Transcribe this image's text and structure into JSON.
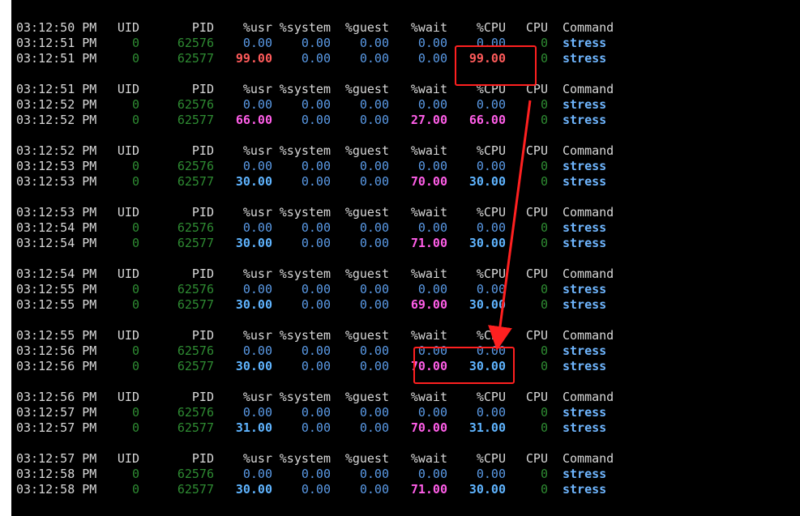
{
  "terminal": {
    "header": {
      "uid": "UID",
      "pid": "PID",
      "usr": "%usr",
      "system": "%system",
      "guest": "%guest",
      "wait": "%wait",
      "cpu_pct": "%CPU",
      "cpu": "CPU",
      "command": "Command"
    },
    "blocks": [
      {
        "header_time": "03:12:50 PM",
        "rows": [
          {
            "time": "03:12:51 PM",
            "uid": "0",
            "pid": "62576",
            "usr": "0.00",
            "system": "0.00",
            "guest": "0.00",
            "wait": "0.00",
            "cpu_pct": "0.00",
            "cpu": "0",
            "command": "stress"
          },
          {
            "time": "03:12:51 PM",
            "uid": "0",
            "pid": "62577",
            "usr": "99.00",
            "system": "0.00",
            "guest": "0.00",
            "wait": "0.00",
            "cpu_pct": "99.00",
            "cpu": "0",
            "command": "stress"
          }
        ]
      },
      {
        "header_time": "03:12:51 PM",
        "rows": [
          {
            "time": "03:12:52 PM",
            "uid": "0",
            "pid": "62576",
            "usr": "0.00",
            "system": "0.00",
            "guest": "0.00",
            "wait": "0.00",
            "cpu_pct": "0.00",
            "cpu": "0",
            "command": "stress"
          },
          {
            "time": "03:12:52 PM",
            "uid": "0",
            "pid": "62577",
            "usr": "66.00",
            "system": "0.00",
            "guest": "0.00",
            "wait": "27.00",
            "cpu_pct": "66.00",
            "cpu": "0",
            "command": "stress"
          }
        ]
      },
      {
        "header_time": "03:12:52 PM",
        "rows": [
          {
            "time": "03:12:53 PM",
            "uid": "0",
            "pid": "62576",
            "usr": "0.00",
            "system": "0.00",
            "guest": "0.00",
            "wait": "0.00",
            "cpu_pct": "0.00",
            "cpu": "0",
            "command": "stress"
          },
          {
            "time": "03:12:53 PM",
            "uid": "0",
            "pid": "62577",
            "usr": "30.00",
            "system": "0.00",
            "guest": "0.00",
            "wait": "70.00",
            "cpu_pct": "30.00",
            "cpu": "0",
            "command": "stress"
          }
        ]
      },
      {
        "header_time": "03:12:53 PM",
        "rows": [
          {
            "time": "03:12:54 PM",
            "uid": "0",
            "pid": "62576",
            "usr": "0.00",
            "system": "0.00",
            "guest": "0.00",
            "wait": "0.00",
            "cpu_pct": "0.00",
            "cpu": "0",
            "command": "stress"
          },
          {
            "time": "03:12:54 PM",
            "uid": "0",
            "pid": "62577",
            "usr": "30.00",
            "system": "0.00",
            "guest": "0.00",
            "wait": "71.00",
            "cpu_pct": "30.00",
            "cpu": "0",
            "command": "stress"
          }
        ]
      },
      {
        "header_time": "03:12:54 PM",
        "rows": [
          {
            "time": "03:12:55 PM",
            "uid": "0",
            "pid": "62576",
            "usr": "0.00",
            "system": "0.00",
            "guest": "0.00",
            "wait": "0.00",
            "cpu_pct": "0.00",
            "cpu": "0",
            "command": "stress"
          },
          {
            "time": "03:12:55 PM",
            "uid": "0",
            "pid": "62577",
            "usr": "30.00",
            "system": "0.00",
            "guest": "0.00",
            "wait": "69.00",
            "cpu_pct": "30.00",
            "cpu": "0",
            "command": "stress"
          }
        ]
      },
      {
        "header_time": "03:12:55 PM",
        "rows": [
          {
            "time": "03:12:56 PM",
            "uid": "0",
            "pid": "62576",
            "usr": "0.00",
            "system": "0.00",
            "guest": "0.00",
            "wait": "0.00",
            "cpu_pct": "0.00",
            "cpu": "0",
            "command": "stress"
          },
          {
            "time": "03:12:56 PM",
            "uid": "0",
            "pid": "62577",
            "usr": "30.00",
            "system": "0.00",
            "guest": "0.00",
            "wait": "70.00",
            "cpu_pct": "30.00",
            "cpu": "0",
            "command": "stress"
          }
        ]
      },
      {
        "header_time": "03:12:56 PM",
        "rows": [
          {
            "time": "03:12:57 PM",
            "uid": "0",
            "pid": "62576",
            "usr": "0.00",
            "system": "0.00",
            "guest": "0.00",
            "wait": "0.00",
            "cpu_pct": "0.00",
            "cpu": "0",
            "command": "stress"
          },
          {
            "time": "03:12:57 PM",
            "uid": "0",
            "pid": "62577",
            "usr": "31.00",
            "system": "0.00",
            "guest": "0.00",
            "wait": "70.00",
            "cpu_pct": "31.00",
            "cpu": "0",
            "command": "stress"
          }
        ]
      },
      {
        "header_time": "03:12:57 PM",
        "rows": [
          {
            "time": "03:12:58 PM",
            "uid": "0",
            "pid": "62576",
            "usr": "0.00",
            "system": "0.00",
            "guest": "0.00",
            "wait": "0.00",
            "cpu_pct": "0.00",
            "cpu": "0",
            "command": "stress"
          },
          {
            "time": "03:12:58 PM",
            "uid": "0",
            "pid": "62577",
            "usr": "30.00",
            "system": "0.00",
            "guest": "0.00",
            "wait": "71.00",
            "cpu_pct": "30.00",
            "cpu": "0",
            "command": "stress"
          }
        ]
      }
    ]
  },
  "colors": {
    "background": "#000000",
    "header_text": "#d8d8d8",
    "id_green": "#2e8b32",
    "value_normal_blue": "#5a9ae6",
    "value_bold_blue": "#5fb4ff",
    "value_bold_magenta": "#ff5ee8",
    "value_bold_red": "#ff5b5b",
    "command_blue": "#6fb6ff",
    "annotation_red": "#ff2020"
  }
}
